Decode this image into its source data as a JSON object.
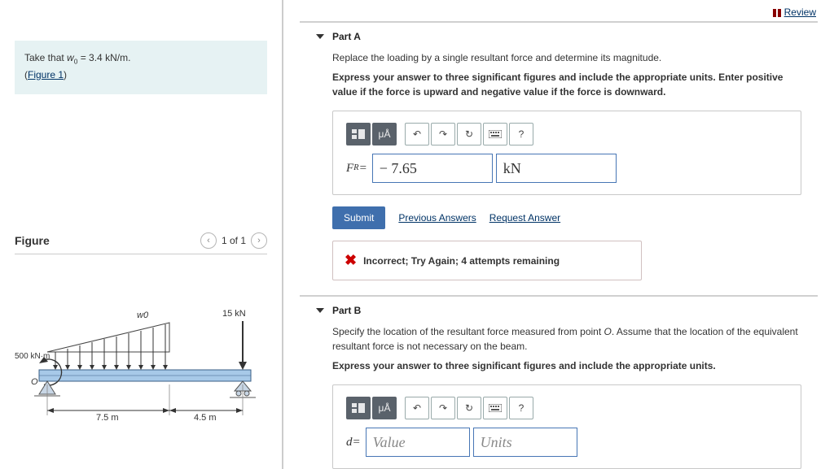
{
  "header": {
    "review": "Review"
  },
  "problem": {
    "given_html": "Take that <i>w</i><sub>0</sub> = 3.4 kN/m.",
    "figure_link": "Figure 1"
  },
  "figure": {
    "title": "Figure",
    "pager": "1 of 1",
    "labels": {
      "w0": "w0",
      "point_load": "15 kN",
      "moment": "500 kN·m",
      "origin": "O",
      "span_left": "7.5 m",
      "span_right": "4.5 m"
    }
  },
  "partA": {
    "title": "Part A",
    "prompt": "Replace the loading by a single resultant force and determine its magnitude.",
    "instr": "Express your answer to three significant figures and include the appropriate units. Enter positive value if the force is upward and negative value if the force is downward.",
    "var_html": "<i>F</i><sub>R</sub> =",
    "value": "− 7.65",
    "units": "kN",
    "submit": "Submit",
    "prev": "Previous Answers",
    "req": "Request Answer",
    "feedback": "Incorrect; Try Again; 4 attempts remaining"
  },
  "partB": {
    "title": "Part B",
    "prompt_html": "Specify the location of the resultant force measured from point <i>O</i>. Assume that the location of the equivalent resultant force is not necessary on the beam.",
    "instr": "Express your answer to three significant figures and include the appropriate units.",
    "var_html": "<i>d</i> =",
    "value_ph": "Value",
    "units_ph": "Units"
  },
  "toolbar": {
    "units_btn": "μÅ",
    "help": "?"
  }
}
